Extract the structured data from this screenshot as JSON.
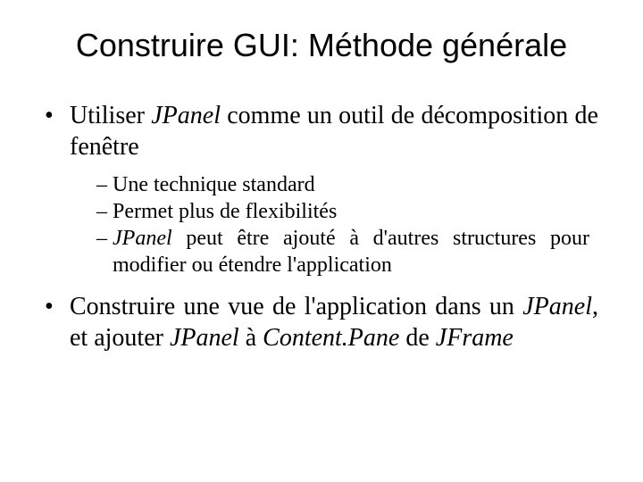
{
  "title": "Construire GUI: Méthode générale",
  "bullets": [
    {
      "marker": "•",
      "segments": [
        {
          "t": "Utiliser ",
          "i": false
        },
        {
          "t": "JPanel",
          "i": true
        },
        {
          "t": " comme un outil de décomposition de fenêtre",
          "i": false
        }
      ],
      "sub": [
        {
          "marker": "–",
          "segments": [
            {
              "t": "Une technique standard",
              "i": false
            }
          ]
        },
        {
          "marker": "–",
          "segments": [
            {
              "t": "Permet plus de flexibilités",
              "i": false
            }
          ]
        },
        {
          "marker": "–",
          "segments": [
            {
              "t": "JPanel",
              "i": true
            },
            {
              "t": " peut être ajouté à d'autres structures pour modifier ou étendre l'application",
              "i": false
            }
          ]
        }
      ]
    },
    {
      "marker": "•",
      "segments": [
        {
          "t": "Construire une vue de l'application dans un ",
          "i": false
        },
        {
          "t": "JPanel",
          "i": true
        },
        {
          "t": ", et ajouter ",
          "i": false
        },
        {
          "t": "JPanel",
          "i": true
        },
        {
          "t": " à ",
          "i": false
        },
        {
          "t": "Content.Pane",
          "i": true
        },
        {
          "t": " de ",
          "i": false
        },
        {
          "t": "JFrame",
          "i": true
        }
      ],
      "sub": []
    }
  ]
}
